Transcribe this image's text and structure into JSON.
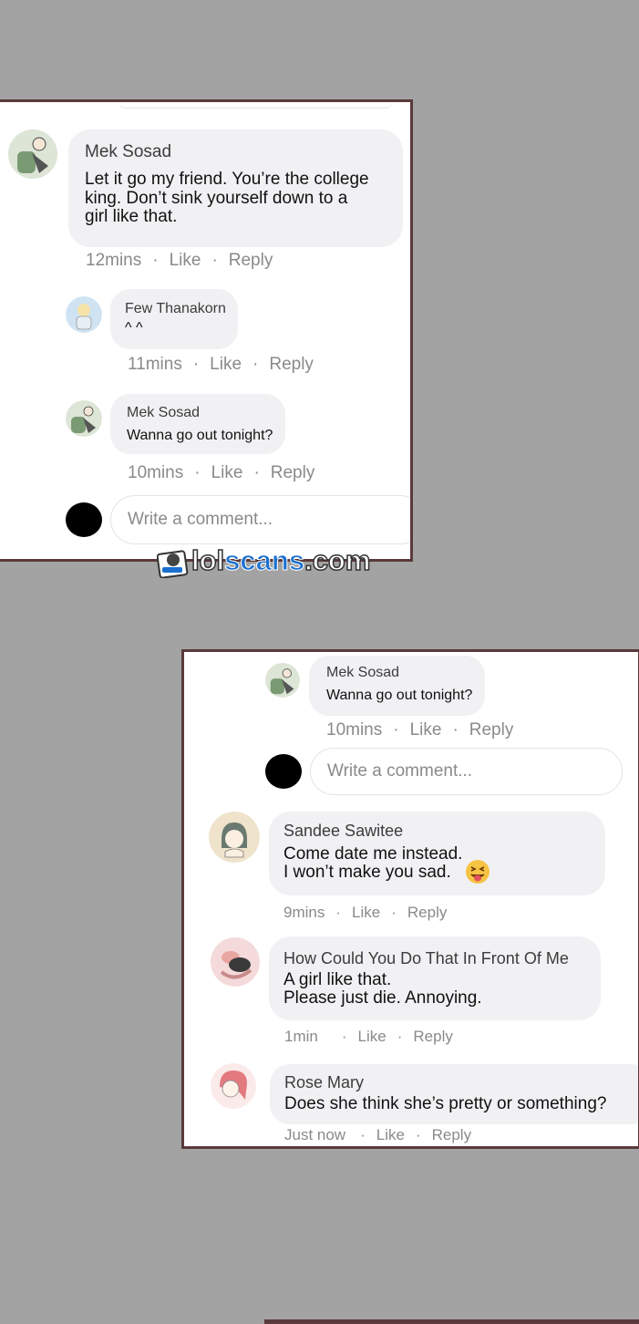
{
  "panel_top": {
    "comments": [
      {
        "name": "Mek Sosad",
        "text_lines": [
          "Let it go my friend. You’re the college",
          "king. Don’t sink yourself down to a",
          "girl like that."
        ],
        "time": "12mins",
        "like": "Like",
        "reply": "Reply"
      },
      {
        "name": "Few Thanakorn",
        "text_lines": [
          "^ ^"
        ],
        "time": "11mins",
        "like": "Like",
        "reply": "Reply"
      },
      {
        "name": "Mek Sosad",
        "text_lines": [
          "Wanna go out tonight?"
        ],
        "time": "10mins",
        "like": "Like",
        "reply": "Reply"
      }
    ],
    "input_placeholder": "Write a comment..."
  },
  "panel_bottom": {
    "comments": [
      {
        "name": "Mek Sosad",
        "text_lines": [
          "Wanna go out tonight?"
        ],
        "time": "10mins",
        "like": "Like",
        "reply": "Reply"
      },
      {
        "name": "Sandee Sawitee",
        "text_lines": [
          "Come date me instead.",
          "I won’t make you sad."
        ],
        "emoji": "😝",
        "time": "9mins",
        "like": "Like",
        "reply": "Reply"
      },
      {
        "name": "How Could You Do That In Front Of Me",
        "text_lines": [
          "A girl like that.",
          "Please just die. Annoying."
        ],
        "time": "1min",
        "like": "Like",
        "reply": "Reply"
      },
      {
        "name": "Rose Mary",
        "text_lines": [
          "Does she think she’s pretty or something?"
        ],
        "time": "Just now",
        "like": "Like",
        "reply": "Reply"
      }
    ],
    "input_placeholder": "Write a comment..."
  },
  "watermark": {
    "part1": "lol",
    "part2": "scans",
    "part3": ".com"
  },
  "separator": "·",
  "icons": {
    "avatar": "user-avatar-icon",
    "blocked": "black-circle-avatar-icon",
    "emoji": "tongue-out-emoji-icon"
  }
}
